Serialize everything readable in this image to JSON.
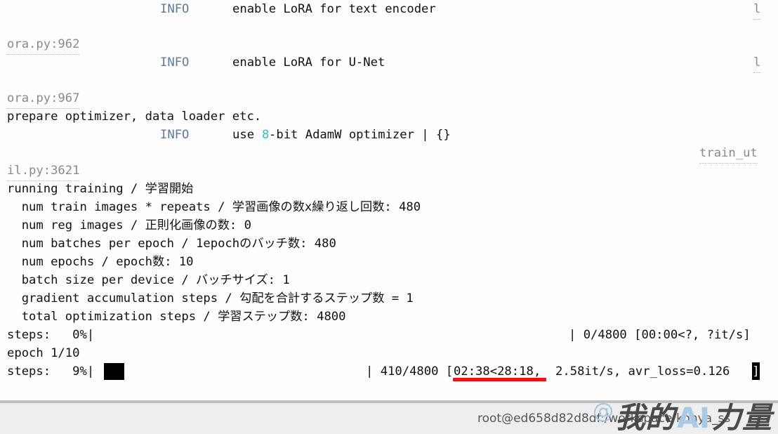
{
  "terminal": {
    "background": "#fdfdfd",
    "foreground": "#111111",
    "info_color": "#5f7a9e",
    "number_color": "#2bc0d8",
    "path_color": "#8a8a8a",
    "char_width": 10.35,
    "line_height": 26,
    "lines": [
      {
        "id": "l0-info",
        "text": "INFO"
      },
      {
        "id": "l0-msg",
        "text": "enable LoRA for text encoder"
      },
      {
        "id": "l0-tail",
        "text": "l"
      },
      {
        "id": "l1-path",
        "text": "ora.py:962"
      },
      {
        "id": "l2-info",
        "text": "INFO"
      },
      {
        "id": "l2-msg",
        "text": "enable LoRA for U-Net"
      },
      {
        "id": "l2-tail",
        "text": "l"
      },
      {
        "id": "l3-path",
        "text": "ora.py:967"
      },
      {
        "id": "l4-msg",
        "text": "prepare optimizer, data loader etc."
      },
      {
        "id": "l5-info",
        "text": "INFO"
      },
      {
        "id": "l5-msg-a",
        "text": "use "
      },
      {
        "id": "l5-msg-num",
        "text": "8"
      },
      {
        "id": "l5-msg-b",
        "text": "-bit AdamW optimizer | {}"
      },
      {
        "id": "l5-tail",
        "text": "train_ut"
      },
      {
        "id": "l6-path",
        "text": "il.py:3621"
      },
      {
        "id": "l7-msg",
        "text": "running training / 学習開始"
      },
      {
        "id": "l8-msg",
        "text": "  num train images * repeats / 学習画像の数x繰り返し回数: 480"
      },
      {
        "id": "l9-msg",
        "text": "  num reg images / 正則化画像の数: 0"
      },
      {
        "id": "l10-msg",
        "text": "  num batches per epoch / 1epochのバッチ数: 480"
      },
      {
        "id": "l11-msg",
        "text": "  num epochs / epoch数: 10"
      },
      {
        "id": "l12-msg",
        "text": "  batch size per device / バッチサイズ: 1"
      },
      {
        "id": "l13-msg",
        "text": "  gradient accumulation steps / 勾配を合計するステップ数 = 1"
      },
      {
        "id": "l14-msg",
        "text": "  total optimization steps / 学習ステップ数: 4800"
      },
      {
        "id": "l15-left",
        "text": "steps:   0%|"
      },
      {
        "id": "l15-right",
        "text": "| 0/4800 [00:00<?, ?it/s]"
      },
      {
        "id": "l16-msg",
        "text": "epoch 1/10"
      },
      {
        "id": "l17-left",
        "text": "steps:   9%|"
      },
      {
        "id": "l17-right",
        "text": "| 410/4800 ["
      },
      {
        "id": "l17-eta",
        "text": "02:38<28:18"
      },
      {
        "id": "l17-rate",
        "text": ",  2.58it/s, avr_loss=0.126"
      },
      {
        "id": "l17-cursor",
        "text": "]"
      }
    ],
    "progress": {
      "first_bar_percent": "0%",
      "first_bar_count": "0/4800",
      "first_bar_elapsed": "00:00",
      "first_bar_eta": "?",
      "first_bar_rate": "?it/s",
      "epoch_label": "epoch 1/10",
      "second_bar_percent": "9%",
      "second_bar_count": "410/4800",
      "second_bar_elapsed": "02:38",
      "second_bar_eta": "28:18",
      "second_bar_rate": "2.58it/s",
      "second_bar_loss": "avr_loss=0.126"
    },
    "annotation": {
      "color": "#ee1111",
      "target_text": "02:38<28:18"
    }
  },
  "statusbar": {
    "prompt": "root@ed658d82d8df:/workspace/kohya_ss",
    "background": "#eeeeee",
    "border_color": "#bfbfbf"
  },
  "watermark": {
    "at": "@",
    "cn_first": "我的",
    "ai": "AI",
    "cn_last": "力量"
  }
}
